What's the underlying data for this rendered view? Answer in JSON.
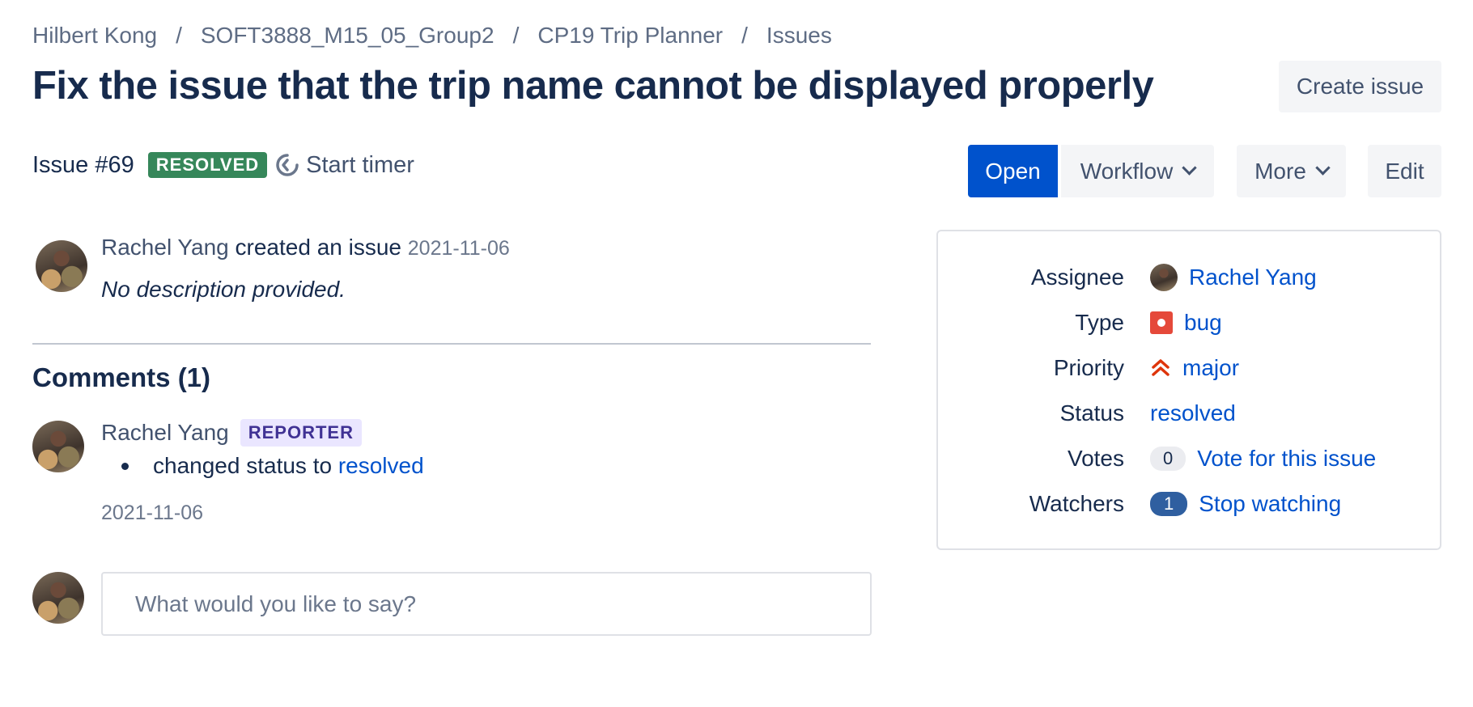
{
  "breadcrumb": [
    "Hilbert Kong",
    "SOFT3888_M15_05_Group2",
    "CP19 Trip Planner",
    "Issues"
  ],
  "breadcrumb_separator": "/",
  "title": "Fix the issue that the trip name cannot be displayed properly",
  "buttons": {
    "create_issue": "Create issue",
    "open": "Open",
    "workflow": "Workflow",
    "more": "More",
    "edit": "Edit"
  },
  "issue": {
    "number": "Issue #69",
    "status_lozenge": "RESOLVED",
    "timer_label": "Start timer"
  },
  "activity": {
    "author": "Rachel Yang",
    "action": "created an issue",
    "date": "2021-11-06",
    "description": "No description provided."
  },
  "comments": {
    "heading": "Comments (1)",
    "items": [
      {
        "author": "Rachel Yang",
        "role": "REPORTER",
        "change_text": "changed status to",
        "change_value": "resolved",
        "date": "2021-11-06"
      }
    ],
    "input_placeholder": "What would you like to say?"
  },
  "sidebar": {
    "assignee_label": "Assignee",
    "assignee_value": "Rachel Yang",
    "type_label": "Type",
    "type_value": "bug",
    "priority_label": "Priority",
    "priority_value": "major",
    "status_label": "Status",
    "status_value": "resolved",
    "votes_label": "Votes",
    "votes_count": "0",
    "votes_link": "Vote for this issue",
    "watchers_label": "Watchers",
    "watchers_count": "1",
    "watchers_link": "Stop watching"
  },
  "colors": {
    "primary": "#0052cc",
    "resolved_green": "#36875a",
    "bug_red": "#e5493a",
    "reporter_purple": "#403294"
  }
}
